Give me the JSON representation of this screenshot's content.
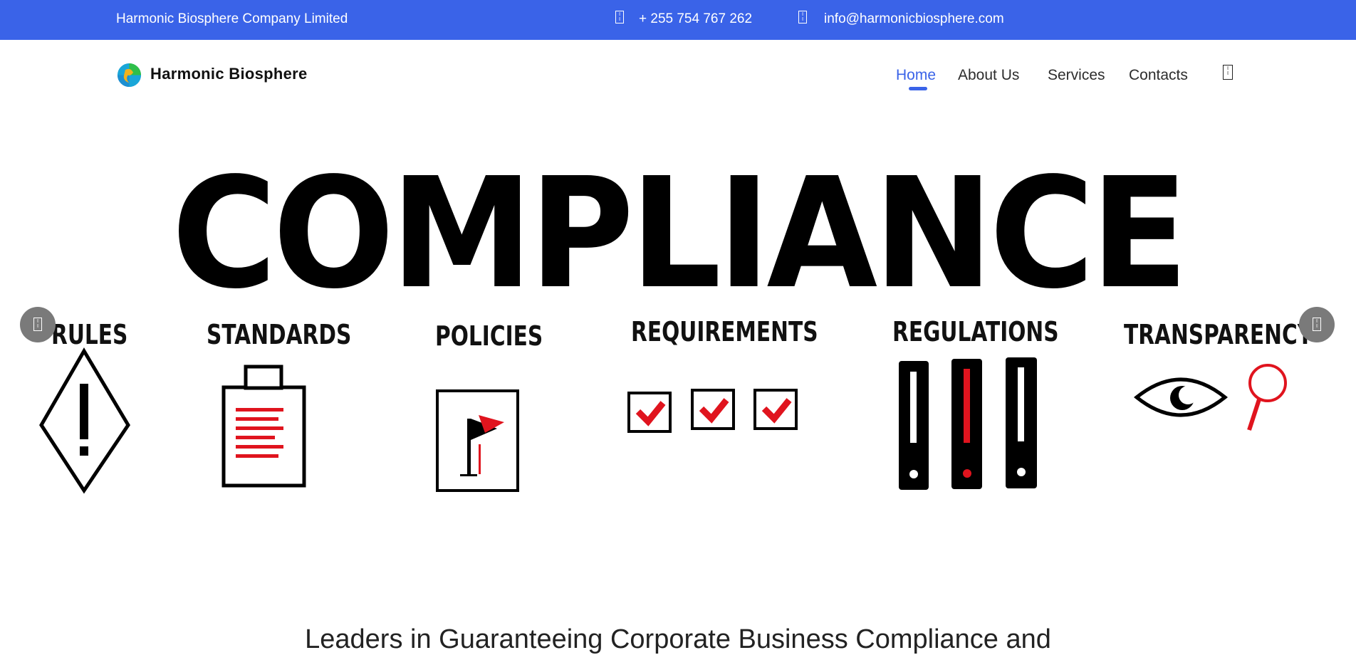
{
  "topbar": {
    "company": "Harmonic Biosphere Company Limited",
    "phone": "+ 255 754 767 262",
    "email": "info@harmonicbiosphere.com",
    "phone_icon": "phone-icon",
    "email_icon": "envelope-icon",
    "background": "#3a63e8"
  },
  "nav": {
    "brand": "Harmonic Biosphere",
    "items": [
      {
        "label": "Home",
        "active": true
      },
      {
        "label": "About Us",
        "active": false
      },
      {
        "label": "Services",
        "active": false
      },
      {
        "label": "Contacts",
        "active": false
      }
    ],
    "search_icon": "search-icon",
    "accent": "#3a63e8"
  },
  "hero": {
    "title": "COMPLIANCE",
    "categories": [
      "RULES",
      "STANDARDS",
      "POLICIES",
      "REQUIREMENTS",
      "REGULATIONS",
      "TRANSPARENCY"
    ],
    "prev_icon": "chevron-left-icon",
    "next_icon": "chevron-right-icon",
    "highlight_color": "#e0141e"
  },
  "main": {
    "heading": "Leaders in Guaranteeing Corporate Business Compliance and"
  }
}
